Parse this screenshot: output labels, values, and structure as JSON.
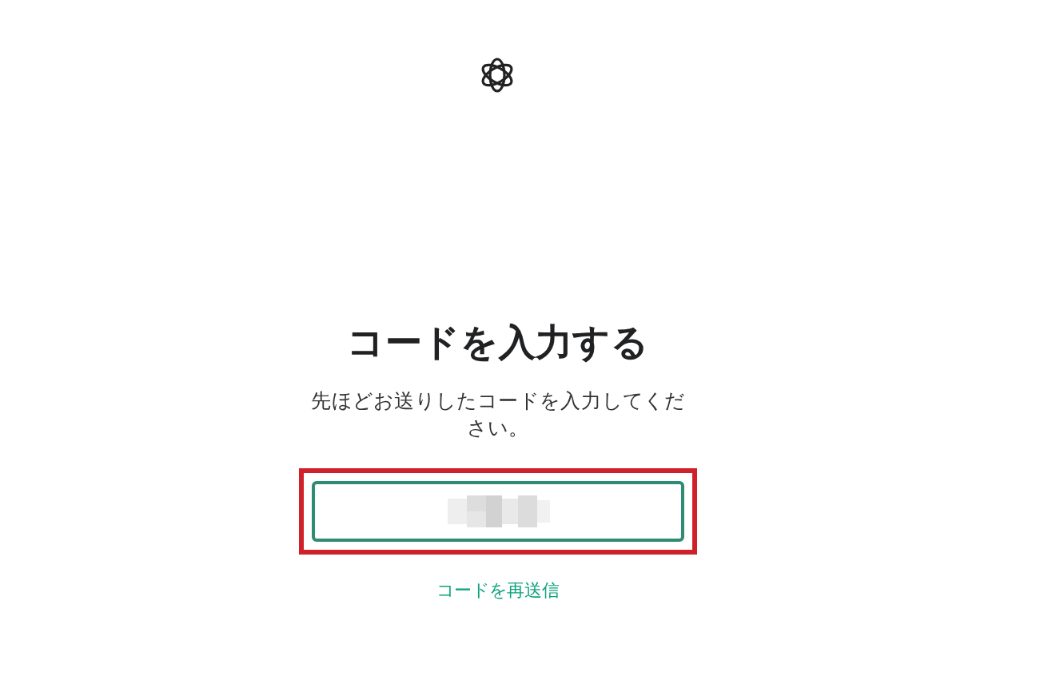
{
  "heading": "コードを入力する",
  "subtitle": "先ほどお送りしたコードを入力してください。",
  "code_field": {
    "highlighted": true
  },
  "resend_link": "コードを再送信"
}
